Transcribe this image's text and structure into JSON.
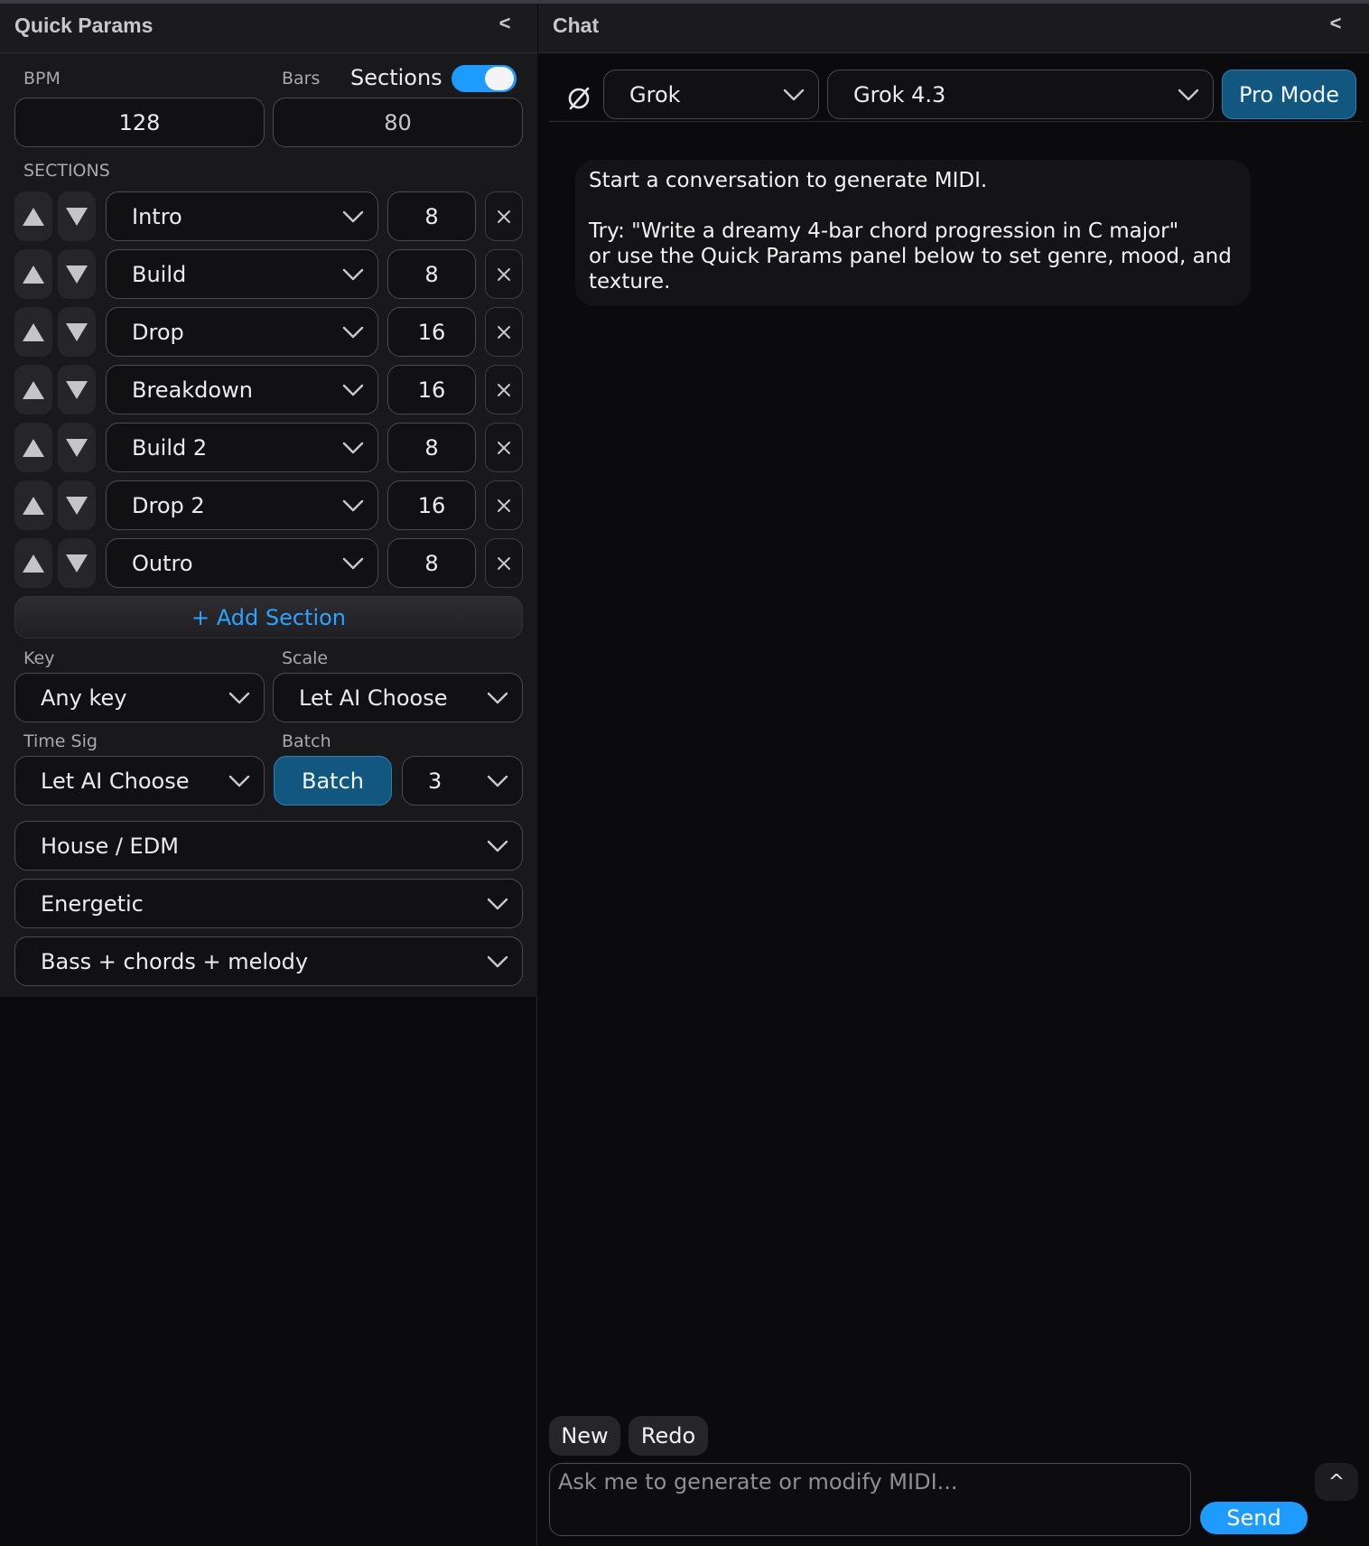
{
  "quick_params": {
    "title": "Quick Params",
    "collapse_label": "<",
    "bpm_label": "BPM",
    "bpm_value": "128",
    "bars_label": "Bars",
    "bars_value": "80",
    "sections_toggle_label": "Sections",
    "sections_toggle_on": true,
    "sections_heading": "SECTIONS",
    "sections": [
      {
        "name": "Intro",
        "bars": "8"
      },
      {
        "name": "Build",
        "bars": "8"
      },
      {
        "name": "Drop",
        "bars": "16"
      },
      {
        "name": "Breakdown",
        "bars": "16"
      },
      {
        "name": "Build 2",
        "bars": "8"
      },
      {
        "name": "Drop 2",
        "bars": "16"
      },
      {
        "name": "Outro",
        "bars": "8"
      }
    ],
    "add_section_label": "+ Add Section",
    "key_label": "Key",
    "key_value": "Any key",
    "scale_label": "Scale",
    "scale_value": "Let AI Choose",
    "time_sig_label": "Time Sig",
    "time_sig_value": "Let AI Choose",
    "batch_label": "Batch",
    "batch_button": "Batch",
    "batch_count": "3",
    "genre_value": "House / EDM",
    "mood_value": "Energetic",
    "texture_value": "Bass + chords + melody"
  },
  "chat": {
    "title": "Chat",
    "collapse_label": "<",
    "provider_value": "Grok",
    "model_value": "Grok 4.3",
    "pro_mode_label": "Pro Mode",
    "intro_message": "Start a conversation to generate MIDI.",
    "intro_hint": "Try: \"Write a dreamy 4-bar chord progression in C major\"\nor use the Quick Params panel below to set genre, mood, and\ntexture.",
    "new_label": "New",
    "redo_label": "Redo",
    "input_placeholder": "Ask me to generate or modify MIDI...",
    "send_label": "Send",
    "expand_label": "^"
  },
  "icons": {
    "model": "refresh-slash-icon",
    "dropdown": "chevron-down-icon",
    "move_up": "triangle-up-icon",
    "move_down": "triangle-down-icon",
    "remove": "close-icon"
  },
  "colors": {
    "accent": "#1e9bff",
    "primary_button": "#11577f",
    "panel_bg": "#19191c",
    "app_bg": "#0b0b0d"
  }
}
